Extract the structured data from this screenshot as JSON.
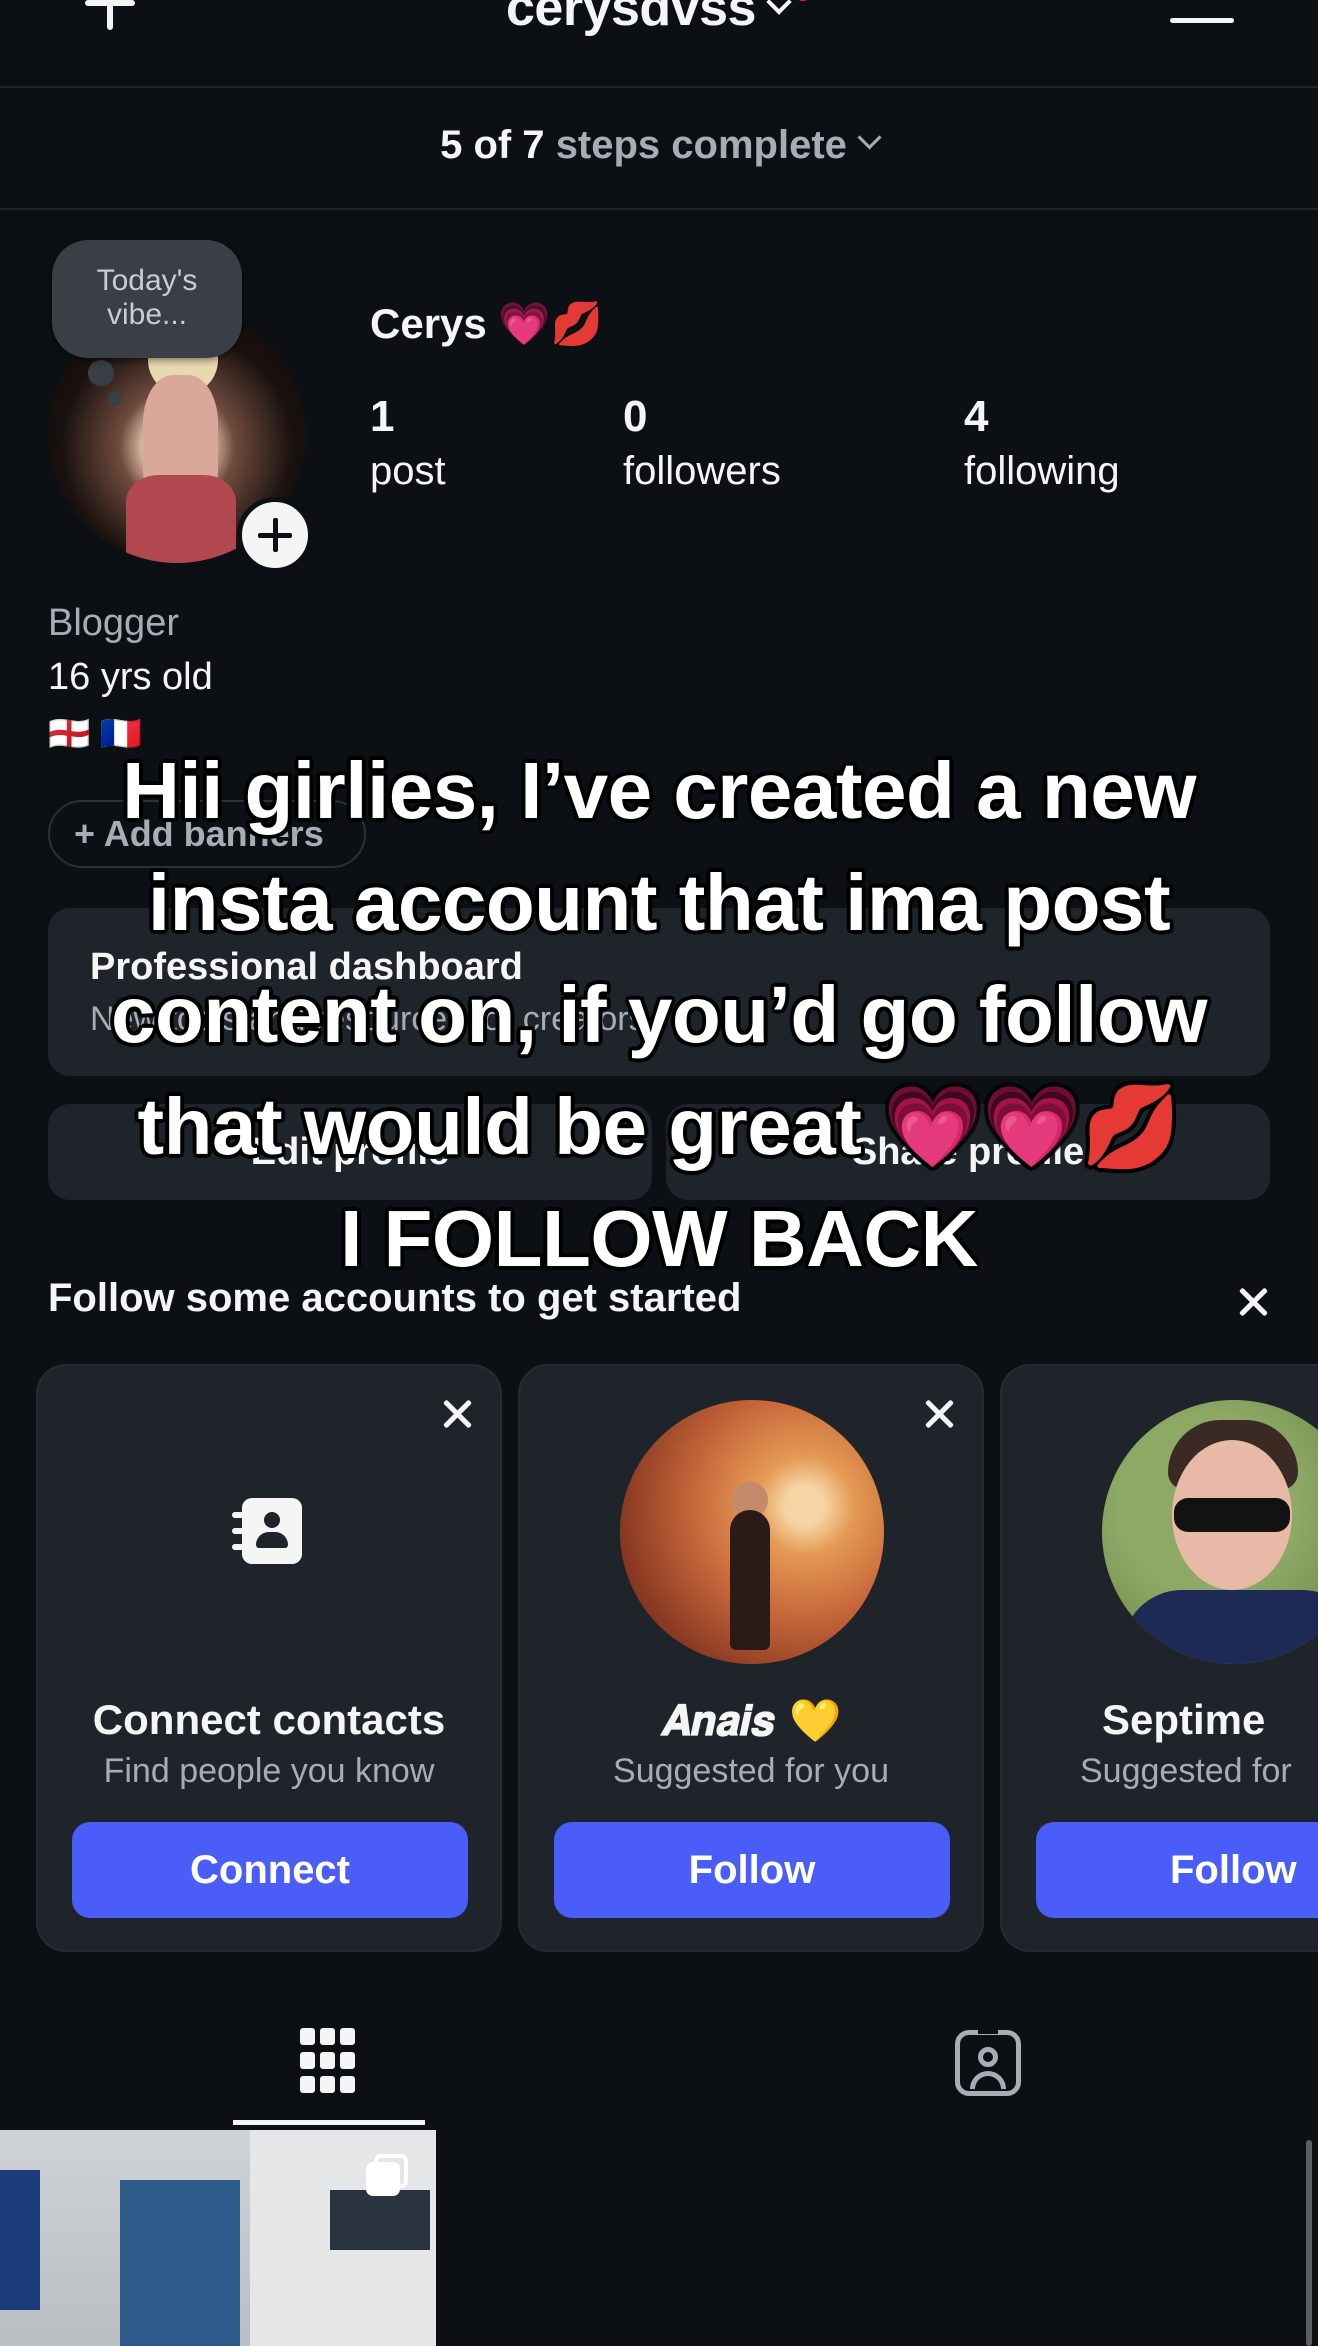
{
  "header": {
    "username": "cerysdvss",
    "new_post_icon": "plus-icon",
    "menu_icon": "hamburger-menu-icon"
  },
  "steps": {
    "count": "5 of 7",
    "label": "steps complete"
  },
  "profile": {
    "vibe_bubble": "Today's vibe...",
    "display_name": "Cerys 💗💋",
    "stats": [
      {
        "num": "1",
        "label": "post"
      },
      {
        "num": "0",
        "label": "followers"
      },
      {
        "num": "4",
        "label": "following"
      }
    ],
    "category": "Blogger",
    "bio": "16 yrs old",
    "flags": "🏴󠁧󠁢󠁥󠁮󠁧󠁿 🇫🇷",
    "add_banners": "+ Add banners",
    "dashboard_title": "Professional dashboard",
    "dashboard_sub": "New tools and resources for creators",
    "edit_profile": "Edit profile",
    "share_profile": "Share profile"
  },
  "caption": {
    "lines": [
      "Hii girlies, I’ve created a new",
      "insta account that ima post",
      "content on, if you’d go follow",
      "that would be great 💗💗💋",
      "I FOLLOW BACK"
    ]
  },
  "suggestions": {
    "title": "Follow some accounts to get started",
    "cards": [
      {
        "name": "Connect contacts",
        "sub": "Find people you know",
        "button": "Connect"
      },
      {
        "name": "𝑨𝒏𝒂𝒊𝒔 💛",
        "sub": "Suggested for you",
        "button": "Follow"
      },
      {
        "name": "Septime",
        "sub": "Suggested for",
        "button": "Follow"
      }
    ]
  },
  "colors": {
    "background": "#0c1014",
    "button_blue": "#4a5df9",
    "card": "#1f242b",
    "secondary_text": "#a8acb3",
    "notification_dot": "#ff1f3d"
  }
}
